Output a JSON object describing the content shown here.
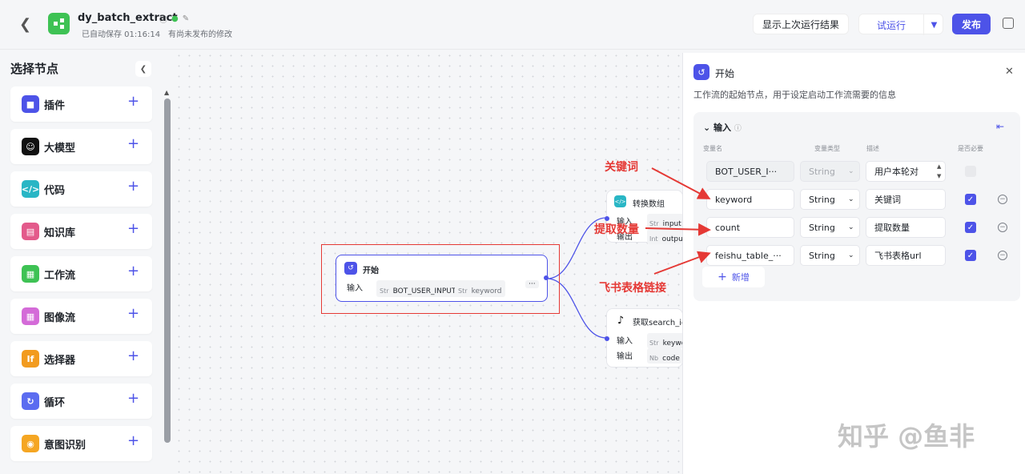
{
  "header": {
    "title": "dy_batch_extract",
    "saved": "已自动保存 01:16:14",
    "unpublished": "有尚未发布的修改",
    "btn_last_result": "显示上次运行结果",
    "btn_test_run": "试运行",
    "btn_publish": "发布"
  },
  "sidebar": {
    "title": "选择节点",
    "items": [
      {
        "label": "插件",
        "color": "#4d53e8"
      },
      {
        "label": "大模型",
        "color": "#111111"
      },
      {
        "label": "代码",
        "color": "#29b6c5"
      },
      {
        "label": "知识库",
        "color": "#e35a8b"
      },
      {
        "label": "工作流",
        "color": "#3ec254"
      },
      {
        "label": "图像流",
        "color": "#d46bd8"
      },
      {
        "label": "选择器",
        "color": "#f29b1f"
      },
      {
        "label": "循环",
        "color": "#5b6cf0"
      },
      {
        "label": "意图识别",
        "color": "#f5a623"
      }
    ]
  },
  "canvas": {
    "start_node": {
      "title": "开始",
      "input_label": "输入",
      "tag1": "Str",
      "var1": "BOT_USER_INPUT",
      "tag2": "Str",
      "var2": "keyword",
      "more": "···"
    },
    "convert_node": {
      "title": "转换数组",
      "input_label": "输入",
      "input_tag": "Str",
      "input_var": "input",
      "output_label": "输出",
      "output_tag": "Int",
      "output_var": "output"
    },
    "search_node": {
      "title": "获取search_ic",
      "input_label": "输入",
      "input_tag": "Str",
      "input_var": "keywor",
      "output_label": "输出",
      "output_tag": "Nb",
      "output_var": "code"
    }
  },
  "panel": {
    "title": "开始",
    "desc": "工作流的起始节点，用于设定启动工作流需要的信息",
    "section": "输入",
    "col_name": "变量名",
    "col_type": "变量类型",
    "col_desc": "描述",
    "col_required": "是否必要",
    "rows": [
      {
        "name": "BOT_USER_I···",
        "type": "String",
        "desc": "用户本轮对"
      },
      {
        "name": "keyword",
        "type": "String",
        "desc": "关键词"
      },
      {
        "name": "count",
        "type": "String",
        "desc": "提取数量"
      },
      {
        "name": "feishu_table_···",
        "type": "String",
        "desc": "飞书表格url"
      }
    ],
    "add_label": "新增"
  },
  "annotations": {
    "a1": "关键词",
    "a2": "提取数量",
    "a3": "飞书表格链接"
  },
  "watermark": "知乎 @鱼非"
}
